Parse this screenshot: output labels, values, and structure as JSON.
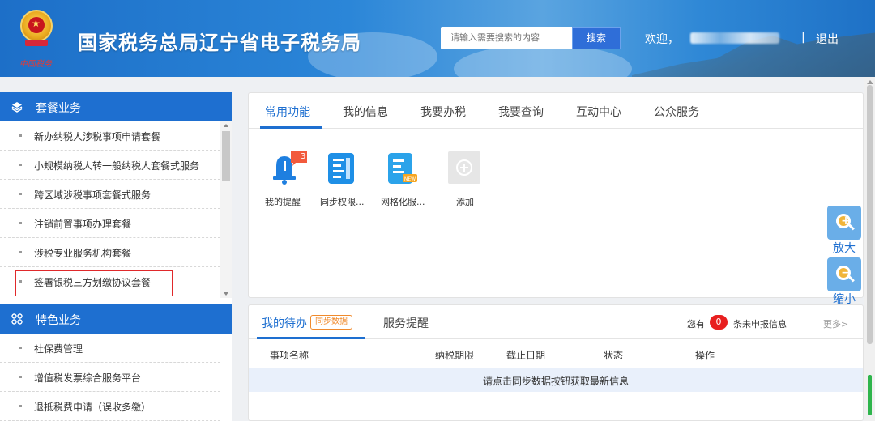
{
  "header": {
    "title": "国家税务总局辽宁省电子税务局",
    "seal_text": "中国税务",
    "search_placeholder": "请输入需要搜索的内容",
    "search_button": "搜索",
    "welcome": "欢迎，",
    "separator": "|",
    "logout": "退出"
  },
  "sidebar": {
    "sections": [
      {
        "title": "套餐业务",
        "icon": "layers-icon",
        "items": [
          "新办纳税人涉税事项申请套餐",
          "小规模纳税人转一般纳税人套餐式服务",
          "跨区域涉税事项套餐式服务",
          "注销前置事项办理套餐",
          "涉税专业服务机构套餐",
          "签署银税三方划缴协议套餐"
        ],
        "highlighted_item": "签署银税三方划缴协议套餐"
      },
      {
        "title": "特色业务",
        "icon": "grid-icon",
        "items": [
          "社保费管理",
          "增值税发票综合服务平台",
          "退抵税费申请（误收多缴）"
        ]
      }
    ]
  },
  "main": {
    "tabs": [
      "常用功能",
      "我的信息",
      "我要办税",
      "我要查询",
      "互动中心",
      "公众服务"
    ],
    "active_tab": "常用功能",
    "apps": [
      {
        "label": "我的提醒",
        "icon": "bell-icon",
        "badge": "3"
      },
      {
        "label": "同步权限...",
        "icon": "document-icon"
      },
      {
        "label": "网格化服...",
        "icon": "new-document-icon",
        "tag": "NEW"
      },
      {
        "label": "添加",
        "icon": "plus-icon"
      }
    ],
    "zoom_in": "放大",
    "zoom_out": "缩小"
  },
  "todo": {
    "tab_active": "我的待办",
    "sync_badge": "同步数据",
    "tab_other": "服务提醒",
    "count_prefix": "您有",
    "count": "0",
    "count_suffix": "条未申报信息",
    "more": "更多>",
    "columns": [
      "事项名称",
      "纳税期限",
      "截止日期",
      "状态",
      "操作"
    ],
    "empty_message": "请点击同步数据按钮获取最新信息"
  },
  "colors": {
    "brand_blue": "#1e6fd0",
    "highlight_red": "#e0292b",
    "badge_orange": "#f08a2c",
    "count_red": "#e81f1f"
  }
}
